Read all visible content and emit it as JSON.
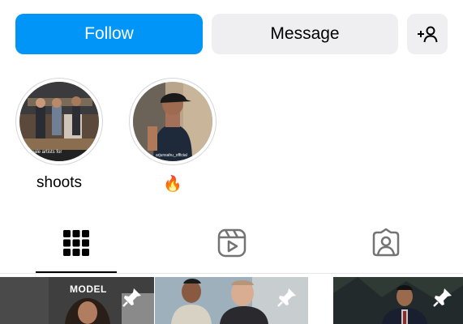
{
  "actions": {
    "follow_label": "Follow",
    "message_label": "Message",
    "suggest_icon": "add-person-icon"
  },
  "highlights": [
    {
      "label": "shoots",
      "caption": "...male artists for"
    },
    {
      "label": "🔥",
      "caption": "arjunsahu_official"
    }
  ],
  "tabs": [
    {
      "name": "posts",
      "icon": "grid-icon",
      "active": true
    },
    {
      "name": "reels",
      "icon": "reels-icon",
      "active": false
    },
    {
      "name": "tagged",
      "icon": "tagged-icon",
      "active": false
    }
  ],
  "grid": [
    {
      "caption": "MODEL",
      "pinned": true,
      "pin_icon": "pin-icon"
    },
    {
      "caption": "",
      "pinned": true,
      "pin_icon": "pin-icon"
    },
    {
      "caption": "",
      "pinned": true,
      "pin_icon": "pin-icon"
    }
  ],
  "colors": {
    "primary": "#0095f6",
    "secondary_button": "#efeff1",
    "text": "#000000"
  }
}
